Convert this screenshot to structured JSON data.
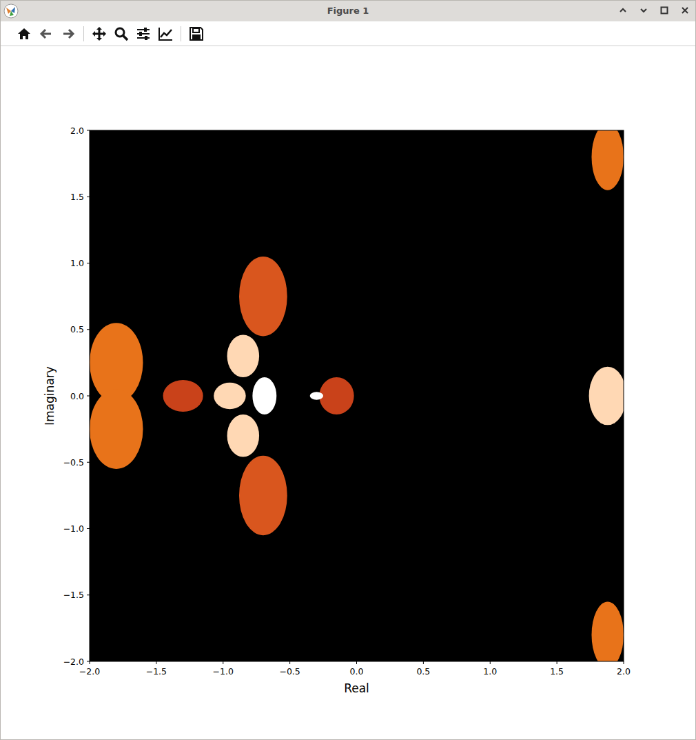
{
  "window": {
    "title": "Figure 1"
  },
  "axes": {
    "x_label": "Real",
    "y_label": "Imaginary",
    "x_ticks": [
      "−2.0",
      "−1.5",
      "−1.0",
      "−0.5",
      "0.0",
      "0.5",
      "1.0",
      "1.5",
      "2.0"
    ],
    "y_ticks": [
      "2.0",
      "1.5",
      "1.0",
      "0.5",
      "0.0",
      "−0.5",
      "−1.0",
      "−1.5",
      "−2.0"
    ]
  },
  "image": {
    "blobs": [
      {
        "x": -1.8,
        "y": 0.25,
        "rx": 0.2,
        "ry": 0.3,
        "color": "#e8731a"
      },
      {
        "x": -1.8,
        "y": -0.25,
        "rx": 0.2,
        "ry": 0.3,
        "color": "#e8731a"
      },
      {
        "x": -1.3,
        "y": 0.0,
        "rx": 0.15,
        "ry": 0.12,
        "color": "#c9421a"
      },
      {
        "x": -0.7,
        "y": 0.75,
        "rx": 0.18,
        "ry": 0.3,
        "color": "#d9561e"
      },
      {
        "x": -0.7,
        "y": -0.75,
        "rx": 0.18,
        "ry": 0.3,
        "color": "#d9561e"
      },
      {
        "x": -0.85,
        "y": 0.3,
        "rx": 0.12,
        "ry": 0.16,
        "color": "#ffd8b4"
      },
      {
        "x": -0.85,
        "y": -0.3,
        "rx": 0.12,
        "ry": 0.16,
        "color": "#ffd8b4"
      },
      {
        "x": -0.95,
        "y": 0.0,
        "rx": 0.12,
        "ry": 0.1,
        "color": "#ffd8b4"
      },
      {
        "x": -0.69,
        "y": 0.0,
        "rx": 0.09,
        "ry": 0.14,
        "color": "#ffffff"
      },
      {
        "x": -0.15,
        "y": 0.0,
        "rx": 0.13,
        "ry": 0.14,
        "color": "#c9421a"
      },
      {
        "x": -0.3,
        "y": 0.0,
        "rx": 0.05,
        "ry": 0.03,
        "color": "#ffffff"
      },
      {
        "x": 1.88,
        "y": 0.0,
        "rx": 0.14,
        "ry": 0.22,
        "color": "#ffd8b4"
      },
      {
        "x": 1.88,
        "y": 1.8,
        "rx": 0.12,
        "ry": 0.25,
        "color": "#e8731a"
      },
      {
        "x": 1.88,
        "y": -1.8,
        "rx": 0.12,
        "ry": 0.25,
        "color": "#e8731a"
      }
    ]
  }
}
